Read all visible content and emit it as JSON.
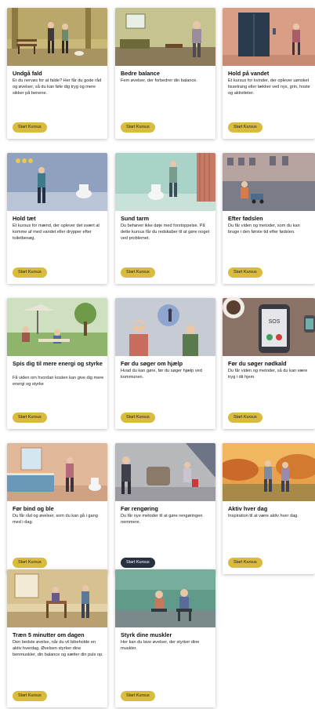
{
  "button_label": "Start Kursus",
  "colors": {
    "button": "#d9bb3f",
    "button_active": "#283140",
    "card_bg": "#ffffff"
  },
  "cards": [
    {
      "title": "Undgå fald",
      "description": "Er du nervøs for at falde? Her får du gode råd og øvelser, så du kan føle dig tryg og mere sikker på benene.",
      "illustration": "park-walk-illustration"
    },
    {
      "title": "Bedre balance",
      "description": "Fem øvelser, der forbedrer din balance.",
      "illustration": "living-room-illustration"
    },
    {
      "title": "Hold på vandet",
      "description": "Et kursus for kvinder, der oplever uønsket tissetrang eller lækker ved nys, grin, hoste og aktiviteter.",
      "illustration": "elevator-illustration"
    },
    {
      "title": "Hold tæt",
      "description": "Et kursus for mænd, der oplever det svært at komme af med vandet eller drypper efter toiletbesøg.",
      "illustration": "bathroom-man-illustration"
    },
    {
      "title": "Sund tarm",
      "description": "Du behøver ikke døje med forstoppelse. På dette kursus får du redskaber til at gøre noget ved problemet.",
      "illustration": "toilet-illustration"
    },
    {
      "title": "Efter fødslen",
      "description": "Du får viden og metoder, som du kan bruge i den første tid efter fødslen.",
      "illustration": "street-stroller-illustration"
    },
    {
      "title": "Spis dig til mere energi og styrke",
      "description": "Få viden om hvordan kosten kan give dig mere energi og styrke",
      "illustration": "picnic-illustration"
    },
    {
      "title": "Før du søger om hjælp",
      "description": "Hvad du kan gøre, før du søger hjælp ved kommunen.",
      "illustration": "conversation-illustration"
    },
    {
      "title": "Før du søger nødkald",
      "description": "Du får viden og metoder, så du kan være tryg i dit hjem.",
      "illustration": "phone-sos-illustration"
    },
    {
      "title": "Før bind og ble",
      "description": "Du får råd og øvelser, som du kan gå i gang med i dag.",
      "illustration": "kitchen-illustration"
    },
    {
      "title": "Før rengøring",
      "description": "Du får nye metoder til at gøre rengøringen nemmere.",
      "illustration": "cleaning-illustration"
    },
    {
      "title": "Aktiv hver dag",
      "description": "Inspiration til at være aktiv hver dag.",
      "illustration": "autumn-walk-illustration"
    },
    {
      "title": "Træn 5 minutter om dagen",
      "description": "Den bedste øvelse, når du vil bibeholde en aktiv hverdag. Øvelsen styrker dine benmuskler, din balance og sætter din puls op.",
      "illustration": "chair-exercise-illustration"
    },
    {
      "title": "Styrk dine muskler",
      "description": "Her kan du lave øvelser, der styrker dine muskler.",
      "illustration": "seated-couple-illustration"
    }
  ]
}
